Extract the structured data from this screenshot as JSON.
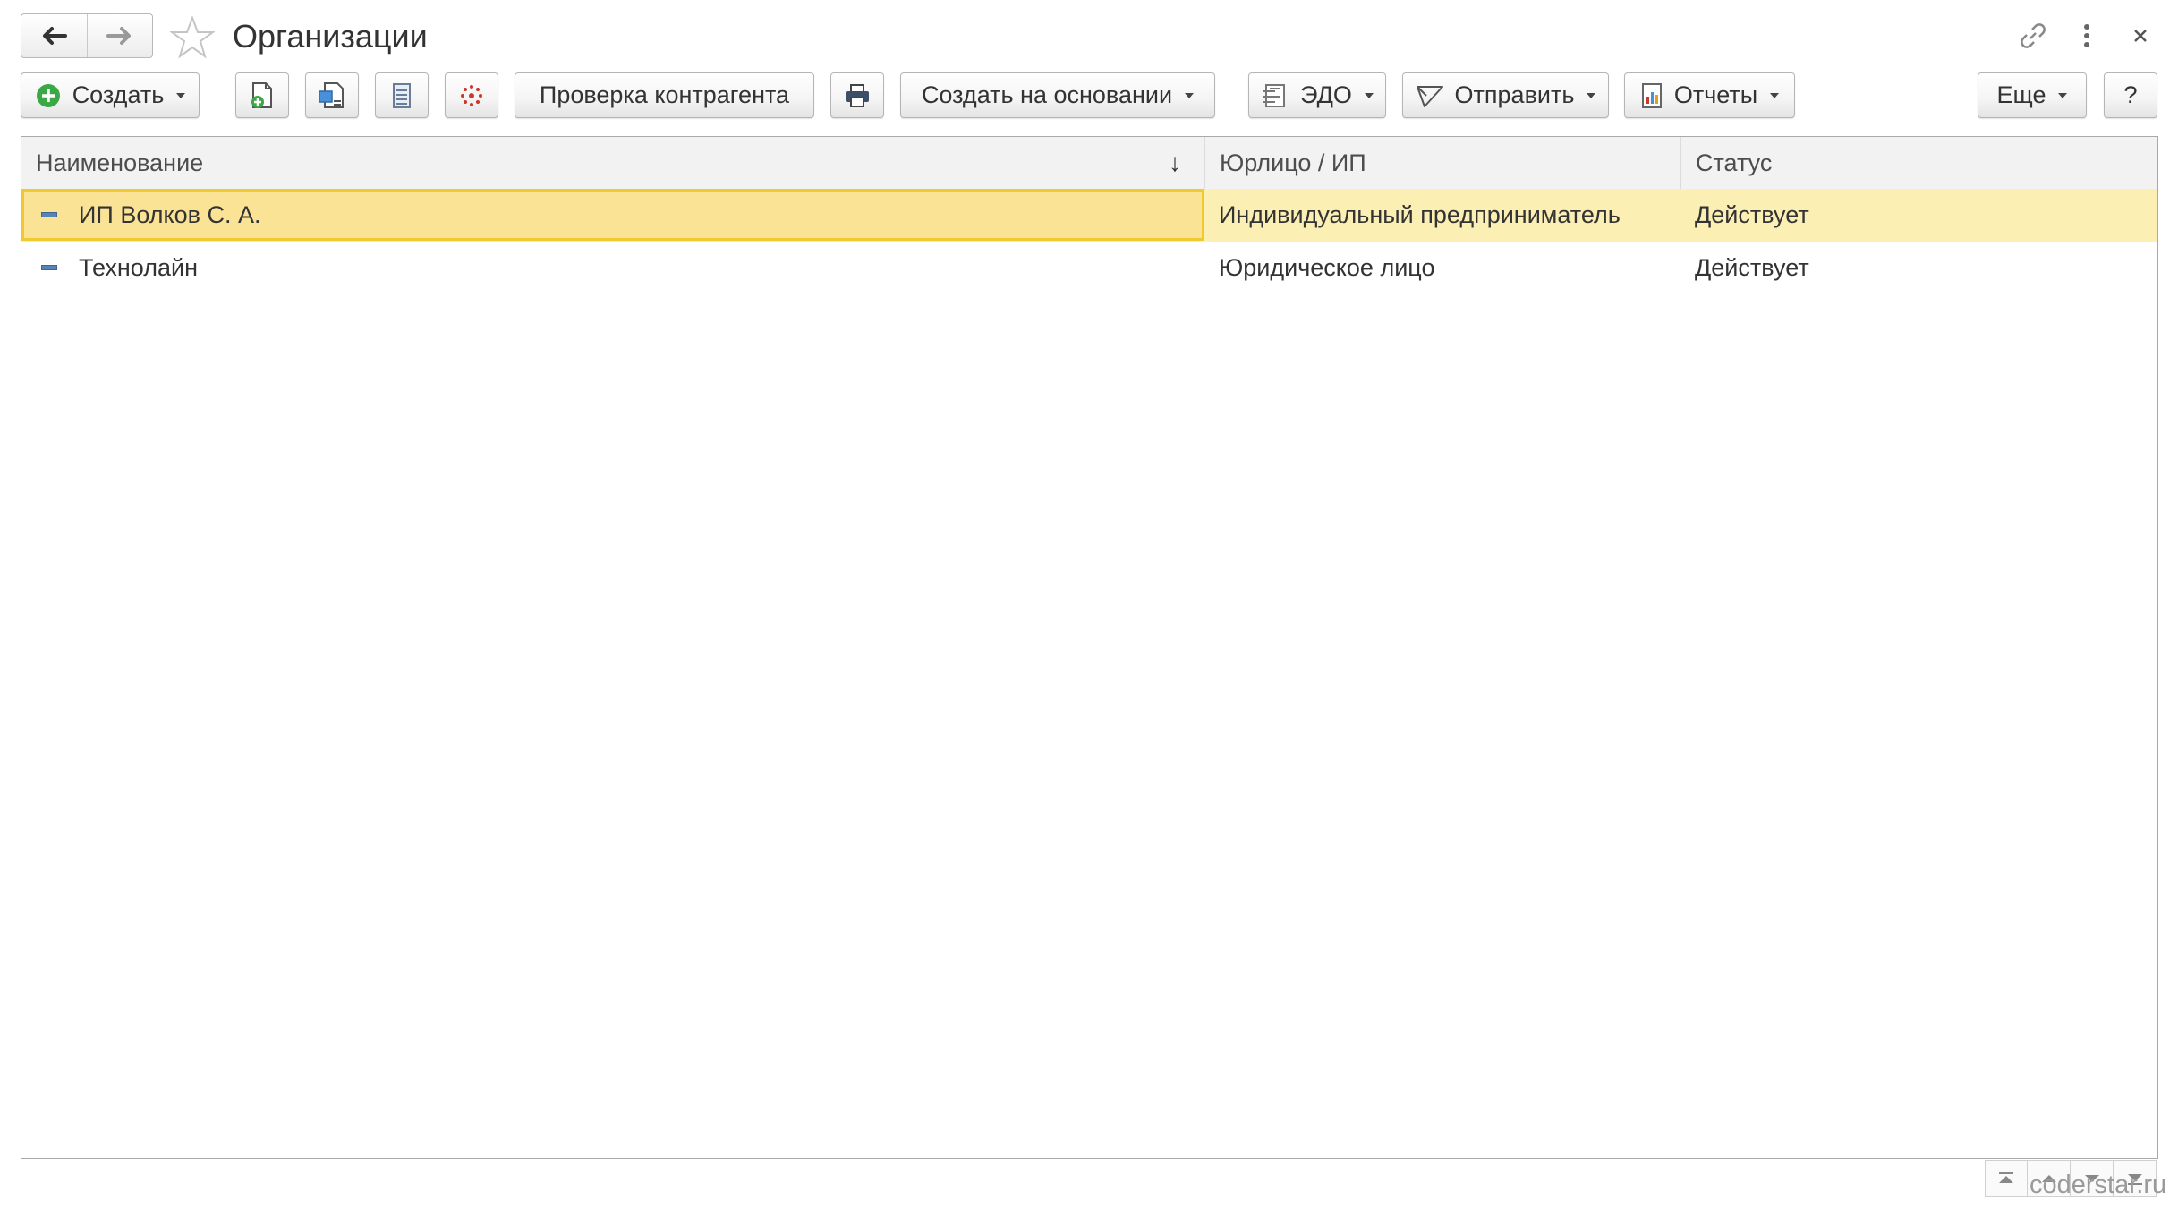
{
  "window": {
    "title": "Организации"
  },
  "toolbar": {
    "create_label": "Создать",
    "check_counterparty_label": "Проверка контрагента",
    "create_based_on_label": "Создать на основании",
    "edo_label": "ЭДО",
    "send_label": "Отправить",
    "reports_label": "Отчеты",
    "more_label": "Еще",
    "help_label": "?"
  },
  "table": {
    "columns": [
      "Наименование",
      "Юрлицо / ИП",
      "Статус"
    ],
    "sort_indicator": "↓",
    "rows": [
      {
        "name": "ИП Волков С. А.",
        "type": "Индивидуальный предприниматель",
        "status": "Действует",
        "selected": true
      },
      {
        "name": "Технолайн",
        "type": "Юридическое лицо",
        "status": "Действует",
        "selected": false
      }
    ]
  },
  "watermark": "coderstar.ru",
  "colors": {
    "selected_row": "#fcefb4",
    "selected_cell_border": "#f0c830",
    "create_icon": "#3aa845"
  },
  "icons": {
    "back": "arrow-left-icon",
    "forward": "arrow-right-icon",
    "favorite": "star-icon",
    "link": "link-icon",
    "menu": "kebab-menu-icon",
    "close": "close-icon"
  }
}
